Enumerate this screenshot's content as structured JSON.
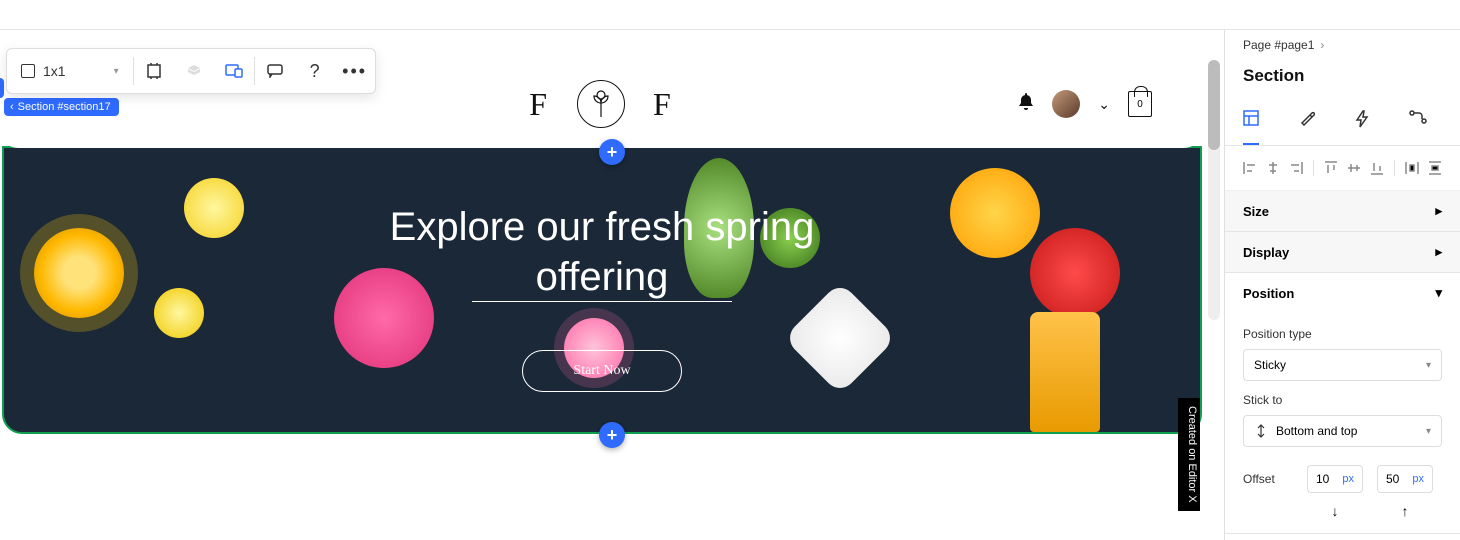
{
  "toolbar": {
    "grid_value": "1x1"
  },
  "section_pill": "Section #section17",
  "site": {
    "logo_letter_left": "F",
    "logo_letter_right": "F",
    "bag_count": "0"
  },
  "hero": {
    "title_line1": "Explore our fresh spring",
    "title_line2": "offering",
    "cta": "Start Now"
  },
  "editor_badge": "Created on Editor X",
  "panel": {
    "breadcrumb": "Page #page1",
    "title": "Section",
    "accordion": {
      "size": "Size",
      "display": "Display",
      "position": "Position"
    },
    "position": {
      "type_label": "Position type",
      "type_value": "Sticky",
      "stick_label": "Stick to",
      "stick_value": "Bottom and top",
      "offset_label": "Offset",
      "offset1_value": "10",
      "offset1_unit": "px",
      "offset2_value": "50",
      "offset2_unit": "px"
    }
  }
}
